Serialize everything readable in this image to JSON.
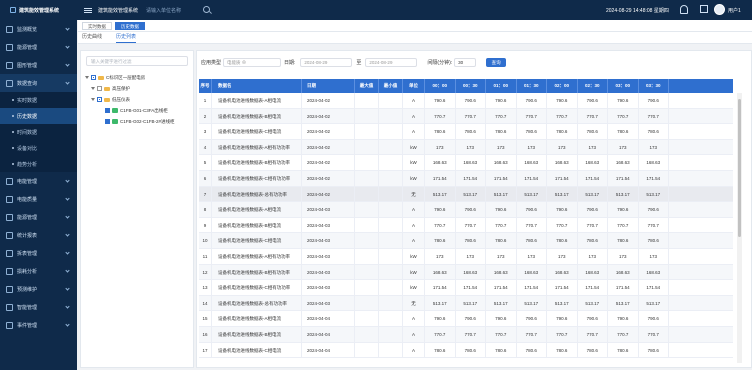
{
  "header": {
    "logo_text": "建筑能效管理系统",
    "system_name": "建筑能效管理系统",
    "search_placeholder": "请输入单位名称",
    "datetime": "2024-08-29 14:48:08 星期四",
    "user": "用户1"
  },
  "sidebar": {
    "items": [
      {
        "label": "监测概览",
        "icon": "monitor-icon"
      },
      {
        "label": "能源管理",
        "icon": "building-icon"
      },
      {
        "label": "图形管理",
        "icon": "graph-icon"
      },
      {
        "label": "数据查询",
        "icon": "database-icon",
        "open": true
      },
      {
        "label": "电能管理",
        "icon": "power-icon"
      },
      {
        "label": "电能质量",
        "icon": "quality-icon"
      },
      {
        "label": "能源管理",
        "icon": "energy-icon"
      },
      {
        "label": "统计报表",
        "icon": "report-icon"
      },
      {
        "label": "拆表管理",
        "icon": "meter-icon"
      },
      {
        "label": "损耗分析",
        "icon": "loss-icon"
      },
      {
        "label": "预测维护",
        "icon": "predict-icon"
      },
      {
        "label": "智能管理",
        "icon": "smart-icon"
      },
      {
        "label": "事件管理",
        "icon": "event-icon"
      }
    ],
    "subitems": [
      {
        "label": "实时数据",
        "active": false
      },
      {
        "label": "历史数据",
        "active": true
      },
      {
        "label": "时间数据",
        "active": false
      },
      {
        "label": "设备对比",
        "active": false
      },
      {
        "label": "趋势分析",
        "active": false
      }
    ]
  },
  "tabs": [
    {
      "label": "实时数据",
      "active": false
    },
    {
      "label": "历史数据",
      "active": true
    }
  ],
  "subtabs": [
    {
      "label": "历史曲线",
      "active": false
    },
    {
      "label": "历史列表",
      "active": true
    }
  ],
  "tree": {
    "search_placeholder": "输入关键字进行过滤",
    "nodes": [
      {
        "label": "C标识区一层配电房",
        "level": 0,
        "type": "folder"
      },
      {
        "label": "高压保护",
        "level": 1,
        "type": "folder"
      },
      {
        "label": "低压仪表",
        "level": 1,
        "type": "folder"
      },
      {
        "label": "C1FB-G01-C3FA出线柜",
        "level": 2,
        "type": "leaf"
      },
      {
        "label": "C1FB-G02-C1FB-2#进线柜",
        "level": 2,
        "type": "leaf"
      }
    ]
  },
  "filters": {
    "type_label": "应用类型",
    "type_value": "电能质 ⊗",
    "date_label": "日期:",
    "date_from": "2024-08-29",
    "date_sep": "至",
    "date_to": "2024-08-29",
    "interval_label": "间隔(分钟):",
    "interval_value": "30",
    "query_button": "查询"
  },
  "table": {
    "headers": [
      "序号",
      "数据名",
      "日期",
      "最大值",
      "最小值",
      "单位",
      "00：00",
      "00：30",
      "01：00",
      "01：30",
      "02：00",
      "02：30",
      "03：00",
      "03：30"
    ],
    "rows": [
      [
        "1",
        "设备机电池进线数据表-A相电流",
        "2024-04-02",
        "",
        "",
        "A",
        "790.6",
        "790.6",
        "790.6",
        "790.6",
        "790.6",
        "790.6",
        "790.6",
        "790.6"
      ],
      [
        "2",
        "设备机电池进线数据表-B相电流",
        "2024-04-02",
        "",
        "",
        "A",
        "770.7",
        "770.7",
        "770.7",
        "770.7",
        "770.7",
        "770.7",
        "770.7",
        "770.7"
      ],
      [
        "3",
        "设备机电池进线数据表-C相电流",
        "2024-04-02",
        "",
        "",
        "A",
        "780.6",
        "780.6",
        "780.6",
        "780.6",
        "780.6",
        "780.6",
        "780.6",
        "780.6"
      ],
      [
        "4",
        "设备机电池进线数据表-A相有功功率",
        "2024-04-02",
        "",
        "",
        "kW",
        "173",
        "173",
        "173",
        "173",
        "173",
        "173",
        "173",
        "173"
      ],
      [
        "5",
        "设备机电池进线数据表-B相有功功率",
        "2024-04-02",
        "",
        "",
        "kW",
        "168.63",
        "168.63",
        "168.63",
        "168.63",
        "168.63",
        "168.63",
        "168.63",
        "168.63"
      ],
      [
        "6",
        "设备机电池进线数据表-C相有功功率",
        "2024-04-02",
        "",
        "",
        "kW",
        "171.54",
        "171.54",
        "171.54",
        "171.54",
        "171.54",
        "171.54",
        "171.54",
        "171.54"
      ],
      [
        "7",
        "设备机电池进线数据表-总有功功率",
        "2024-04-02",
        "",
        "",
        "无",
        "513.17",
        "513.17",
        "513.17",
        "513.17",
        "513.17",
        "513.17",
        "513.17",
        "513.17"
      ],
      [
        "8",
        "设备机电池进线数据表-A相电流",
        "2024-04-03",
        "",
        "",
        "A",
        "790.6",
        "790.6",
        "790.6",
        "790.6",
        "790.6",
        "790.6",
        "790.6",
        "790.6"
      ],
      [
        "9",
        "设备机电池进线数据表-B相电流",
        "2024-04-03",
        "",
        "",
        "A",
        "770.7",
        "770.7",
        "770.7",
        "770.7",
        "770.7",
        "770.7",
        "770.7",
        "770.7"
      ],
      [
        "10",
        "设备机电池进线数据表-C相电流",
        "2024-04-03",
        "",
        "",
        "A",
        "780.6",
        "780.6",
        "780.6",
        "780.6",
        "780.6",
        "780.6",
        "780.6",
        "780.6"
      ],
      [
        "11",
        "设备机电池进线数据表-A相有功功率",
        "2024-04-03",
        "",
        "",
        "kW",
        "173",
        "173",
        "173",
        "173",
        "173",
        "173",
        "173",
        "173"
      ],
      [
        "12",
        "设备机电池进线数据表-B相有功功率",
        "2024-04-03",
        "",
        "",
        "kW",
        "168.63",
        "168.63",
        "168.63",
        "168.63",
        "168.63",
        "168.63",
        "168.63",
        "168.63"
      ],
      [
        "13",
        "设备机电池进线数据表-C相有功功率",
        "2024-04-03",
        "",
        "",
        "kW",
        "171.54",
        "171.54",
        "171.54",
        "171.54",
        "171.54",
        "171.54",
        "171.54",
        "171.54"
      ],
      [
        "14",
        "设备机电池进线数据表-总有功功率",
        "2024-04-03",
        "",
        "",
        "无",
        "513.17",
        "513.17",
        "513.17",
        "513.17",
        "513.17",
        "513.17",
        "513.17",
        "513.17"
      ],
      [
        "15",
        "设备机电池进线数据表-A相电流",
        "2024-04-04",
        "",
        "",
        "A",
        "790.6",
        "790.6",
        "790.6",
        "790.6",
        "790.6",
        "790.6",
        "790.6",
        "790.6"
      ],
      [
        "16",
        "设备机电池进线数据表-B相电流",
        "2024-04-04",
        "",
        "",
        "A",
        "770.7",
        "770.7",
        "770.7",
        "770.7",
        "770.7",
        "770.7",
        "770.7",
        "770.7"
      ],
      [
        "17",
        "设备机电池进线数据表-C相电流",
        "2024-04-04",
        "",
        "",
        "A",
        "780.6",
        "780.6",
        "780.6",
        "780.6",
        "780.6",
        "780.6",
        "780.6",
        "780.6"
      ]
    ]
  }
}
